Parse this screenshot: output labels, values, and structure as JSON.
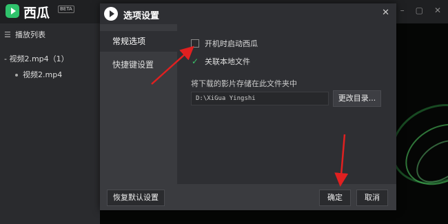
{
  "app": {
    "name": "西瓜",
    "badge": "BETA",
    "accent": "#2fc26b"
  },
  "playlist": {
    "header": "播放列表",
    "header_icon": "list-icon",
    "group_label": "- 视频2.mp4（1）",
    "items": [
      "视频2.mp4"
    ]
  },
  "dialog": {
    "title": "选项设置",
    "close_icon": "close-icon",
    "nav": [
      {
        "label": "常规选项",
        "active": true
      },
      {
        "label": "快捷键设置",
        "active": false
      }
    ],
    "options": {
      "autostart": {
        "label": "开机时启动西瓜",
        "checked": false
      },
      "associate": {
        "label": "关联本地文件",
        "checked": true
      }
    },
    "save_label": "将下载的影片存储在此文件夹中",
    "save_path": "D:\\XiGua Yingshi",
    "browse_label": "更改目录...",
    "footer": {
      "reset_label": "恢复默认设置",
      "ok_label": "确定",
      "cancel_label": "取消"
    }
  },
  "annotation_color": "#e02020"
}
